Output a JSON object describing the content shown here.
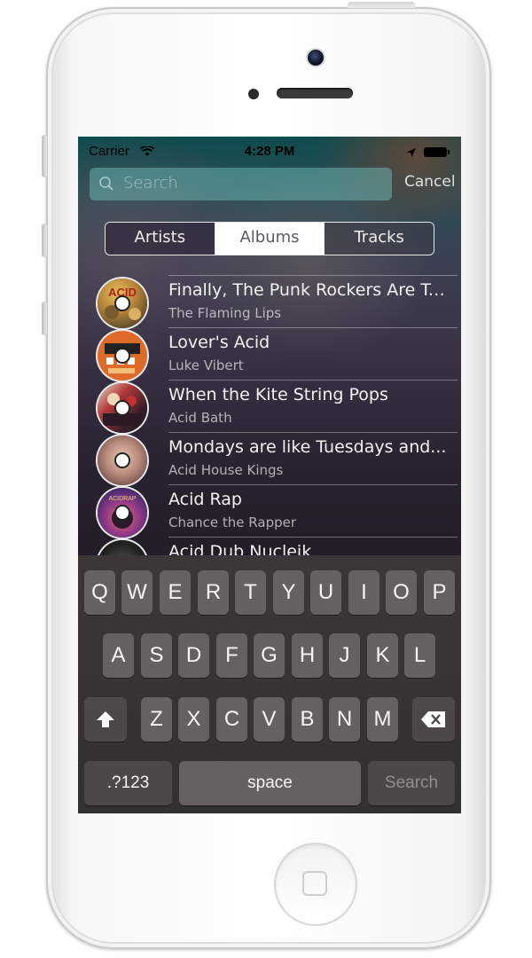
{
  "status_bar": {
    "carrier": "Carrier",
    "time": "4:28 PM"
  },
  "search": {
    "placeholder": "Search",
    "cancel_label": "Cancel"
  },
  "segments": [
    {
      "label": "Artists",
      "selected": false
    },
    {
      "label": "Albums",
      "selected": true
    },
    {
      "label": "Tracks",
      "selected": false
    }
  ],
  "albums": [
    {
      "title": "Finally, The Punk Rockers Are Ta...",
      "artist": "The Flaming Lips",
      "art_color": "#c8a24a"
    },
    {
      "title": "Lover's Acid",
      "artist": "Luke Vibert",
      "art_color": "#d9692a"
    },
    {
      "title": "When the Kite String Pops",
      "artist": "Acid Bath",
      "art_color": "#7a2b35"
    },
    {
      "title": "Mondays are like Tuesdays and...",
      "artist": "Acid House Kings",
      "art_color": "#b98a80"
    },
    {
      "title": "Acid Rap",
      "artist": "Chance the Rapper",
      "art_color": "#a04a8a"
    },
    {
      "title": "Acid Dub Nucleik",
      "artist": "",
      "art_color": "#3a3a3a"
    }
  ],
  "keyboard": {
    "row1": [
      "Q",
      "W",
      "E",
      "R",
      "T",
      "Y",
      "U",
      "I",
      "O",
      "P"
    ],
    "row2": [
      "A",
      "S",
      "D",
      "F",
      "G",
      "H",
      "J",
      "K",
      "L"
    ],
    "row3": [
      "Z",
      "X",
      "C",
      "V",
      "B",
      "N",
      "M"
    ],
    "numbers_label": ".?123",
    "space_label": "space",
    "search_label": "Search"
  }
}
